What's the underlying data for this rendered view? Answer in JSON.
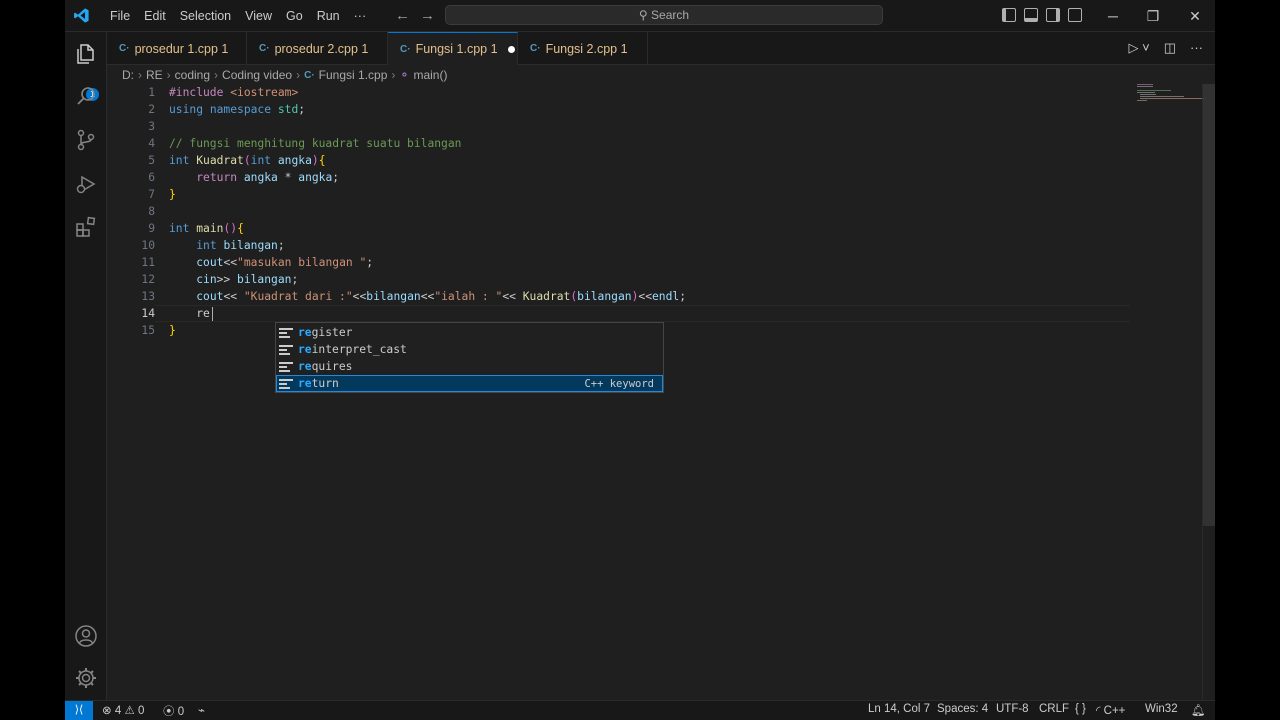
{
  "menu": [
    "File",
    "Edit",
    "Selection",
    "View",
    "Go",
    "Run",
    "···"
  ],
  "search": {
    "label": "Search"
  },
  "tabs": [
    {
      "label": "prosedur 1.cpp 1",
      "active": false
    },
    {
      "label": "prosedur 2.cpp 1",
      "active": false
    },
    {
      "label": "Fungsi 1.cpp 1",
      "active": true,
      "modified": true
    },
    {
      "label": "Fungsi 2.cpp 1",
      "active": false
    }
  ],
  "breadcrumb": [
    "D:",
    "RE",
    "coding",
    "Coding video",
    "Fungsi 1.cpp",
    "main()"
  ],
  "activity": {
    "explorer_badge": "1"
  },
  "editor": {
    "line_numbers": [
      "1",
      "2",
      "3",
      "4",
      "5",
      "6",
      "7",
      "8",
      "9",
      "10",
      "11",
      "12",
      "13",
      "14",
      "15"
    ],
    "current_line": "14",
    "lines": [
      "#include <iostream>",
      "using namespace std;",
      "",
      "// fungsi menghitung kuadrat suatu bilangan",
      "int Kuadrat(int angka){",
      "    return angka * angka;",
      "}",
      "",
      "int main(){",
      "    int bilangan;",
      "    cout<<\"masukan bilangan \";",
      "    cin>> bilangan;",
      "    cout<< \"Kuadrat dari :\"<<bilangan<<\"ialah : \"<< Kuadrat(bilangan)<<endl;",
      "    re",
      "}"
    ]
  },
  "suggestions": {
    "typed_prefix": "re",
    "items": [
      {
        "label": "register",
        "selected": false
      },
      {
        "label": "reinterpret_cast",
        "selected": false
      },
      {
        "label": "requires",
        "selected": false
      },
      {
        "label": "return",
        "selected": true,
        "detail": "C++ keyword"
      }
    ]
  },
  "status": {
    "errors": "4",
    "warnings": "0",
    "ports": "0",
    "position": "Ln 14, Col 7",
    "spaces": "Spaces: 4",
    "encoding": "UTF-8",
    "eol": "CRLF",
    "braces": "{ }",
    "language": "C++",
    "platform": "Win32"
  },
  "colors": {
    "accent": "#0078d4",
    "modified_tab_text": "#e2c08d",
    "keyword": "#569cd6",
    "comment": "#6a9955",
    "string": "#ce9178"
  }
}
